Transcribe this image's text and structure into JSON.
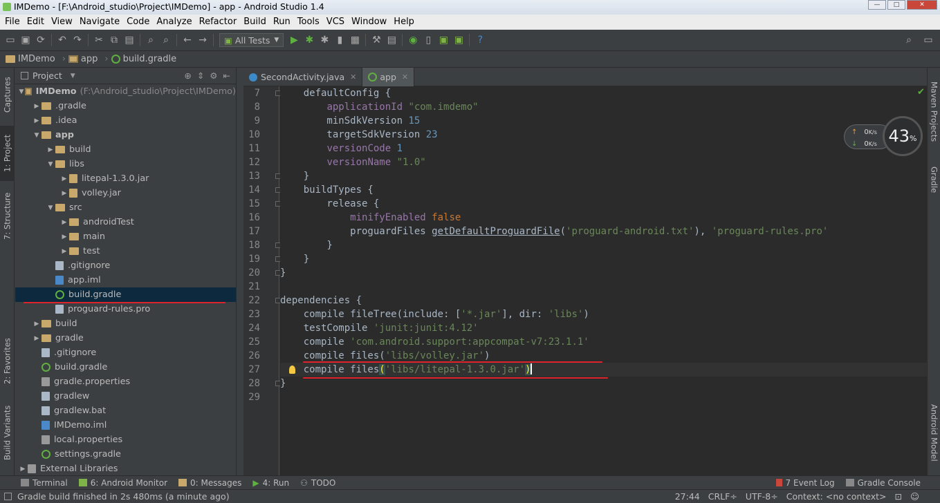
{
  "window": {
    "title": "IMDemo - [F:\\Android_studio\\Project\\IMDemo] - app - Android Studio 1.4"
  },
  "menu": [
    "File",
    "Edit",
    "View",
    "Navigate",
    "Code",
    "Analyze",
    "Refactor",
    "Build",
    "Run",
    "Tools",
    "VCS",
    "Window",
    "Help"
  ],
  "toolbar": {
    "run_config": "All Tests"
  },
  "breadcrumb": [
    "IMDemo",
    "app",
    "build.gradle"
  ],
  "left_tabs": [
    "1: Project",
    "7: Structure",
    "Captures",
    "2: Favorites",
    "Build Variants"
  ],
  "right_tabs": [
    "Maven Projects",
    "Gradle",
    "Android Model"
  ],
  "project_panel": {
    "title": "Project",
    "root_name": "IMDemo",
    "root_path": "(F:\\Android_studio\\Project\\IMDemo)",
    "tree": [
      {
        "label": ".gradle",
        "depth": 1,
        "toggle": "▶",
        "type": "folder"
      },
      {
        "label": ".idea",
        "depth": 1,
        "toggle": "▶",
        "type": "folder"
      },
      {
        "label": "app",
        "depth": 1,
        "toggle": "▼",
        "type": "folder"
      },
      {
        "label": "build",
        "depth": 2,
        "toggle": "▶",
        "type": "folder"
      },
      {
        "label": "libs",
        "depth": 2,
        "toggle": "▼",
        "type": "folder"
      },
      {
        "label": "litepal-1.3.0.jar",
        "depth": 3,
        "toggle": "▶",
        "type": "jar"
      },
      {
        "label": "volley.jar",
        "depth": 3,
        "toggle": "▶",
        "type": "jar"
      },
      {
        "label": "src",
        "depth": 2,
        "toggle": "▼",
        "type": "folder"
      },
      {
        "label": "androidTest",
        "depth": 3,
        "toggle": "▶",
        "type": "folder"
      },
      {
        "label": "main",
        "depth": 3,
        "toggle": "▶",
        "type": "folder"
      },
      {
        "label": "test",
        "depth": 3,
        "toggle": "▶",
        "type": "folder"
      },
      {
        "label": ".gitignore",
        "depth": 2,
        "toggle": "",
        "type": "file"
      },
      {
        "label": "app.iml",
        "depth": 2,
        "toggle": "",
        "type": "iml"
      },
      {
        "label": "build.gradle",
        "depth": 2,
        "toggle": "",
        "type": "gradle"
      },
      {
        "label": "proguard-rules.pro",
        "depth": 2,
        "toggle": "",
        "type": "file"
      },
      {
        "label": "build",
        "depth": 1,
        "toggle": "▶",
        "type": "folder"
      },
      {
        "label": "gradle",
        "depth": 1,
        "toggle": "▶",
        "type": "folder"
      },
      {
        "label": ".gitignore",
        "depth": 1,
        "toggle": "",
        "type": "file"
      },
      {
        "label": "build.gradle",
        "depth": 1,
        "toggle": "",
        "type": "gradle"
      },
      {
        "label": "gradle.properties",
        "depth": 1,
        "toggle": "",
        "type": "prop"
      },
      {
        "label": "gradlew",
        "depth": 1,
        "toggle": "",
        "type": "file"
      },
      {
        "label": "gradlew.bat",
        "depth": 1,
        "toggle": "",
        "type": "file"
      },
      {
        "label": "IMDemo.iml",
        "depth": 1,
        "toggle": "",
        "type": "iml"
      },
      {
        "label": "local.properties",
        "depth": 1,
        "toggle": "",
        "type": "prop"
      },
      {
        "label": "settings.gradle",
        "depth": 1,
        "toggle": "",
        "type": "gradle"
      },
      {
        "label": "External Libraries",
        "depth": 0,
        "toggle": "▶",
        "type": "lib"
      }
    ]
  },
  "editor": {
    "tabs": [
      {
        "label": "SecondActivity.java",
        "active": false
      },
      {
        "label": "app",
        "active": true
      }
    ],
    "line_numbers": [
      "7",
      "8",
      "9",
      "10",
      "11",
      "12",
      "13",
      "14",
      "15",
      "16",
      "17",
      "18",
      "19",
      "20",
      "21",
      "22",
      "23",
      "24",
      "25",
      "26",
      "27",
      "28",
      "29"
    ],
    "lines": [
      [
        {
          "t": "    defaultConfig {",
          "c": ""
        }
      ],
      [
        {
          "t": "        ",
          "c": ""
        },
        {
          "t": "applicationId",
          "c": "p"
        },
        {
          "t": " ",
          "c": ""
        },
        {
          "t": "\"com.imdemo\"",
          "c": "s"
        }
      ],
      [
        {
          "t": "        minSdkVersion ",
          "c": ""
        },
        {
          "t": "15",
          "c": "n"
        }
      ],
      [
        {
          "t": "        targetSdkVersion ",
          "c": ""
        },
        {
          "t": "23",
          "c": "n"
        }
      ],
      [
        {
          "t": "        ",
          "c": ""
        },
        {
          "t": "versionCode",
          "c": "p"
        },
        {
          "t": " ",
          "c": ""
        },
        {
          "t": "1",
          "c": "n"
        }
      ],
      [
        {
          "t": "        ",
          "c": ""
        },
        {
          "t": "versionName",
          "c": "p"
        },
        {
          "t": " ",
          "c": ""
        },
        {
          "t": "\"1.0\"",
          "c": "s"
        }
      ],
      [
        {
          "t": "    }",
          "c": ""
        }
      ],
      [
        {
          "t": "    buildTypes {",
          "c": ""
        }
      ],
      [
        {
          "t": "        release {",
          "c": ""
        }
      ],
      [
        {
          "t": "            ",
          "c": ""
        },
        {
          "t": "minifyEnabled",
          "c": "p"
        },
        {
          "t": " ",
          "c": ""
        },
        {
          "t": "false",
          "c": "k"
        }
      ],
      [
        {
          "t": "            proguardFiles ",
          "c": ""
        },
        {
          "t": "getDefaultProguardFile",
          "c": "u"
        },
        {
          "t": "(",
          "c": ""
        },
        {
          "t": "'proguard-android.txt'",
          "c": "s"
        },
        {
          "t": "), ",
          "c": ""
        },
        {
          "t": "'proguard-rules.pro'",
          "c": "s"
        }
      ],
      [
        {
          "t": "        }",
          "c": ""
        }
      ],
      [
        {
          "t": "    }",
          "c": ""
        }
      ],
      [
        {
          "t": "}",
          "c": ""
        }
      ],
      [
        {
          "t": "",
          "c": ""
        }
      ],
      [
        {
          "t": "dependencies {",
          "c": ""
        }
      ],
      [
        {
          "t": "    compile fileTree(include: [",
          "c": ""
        },
        {
          "t": "'*.jar'",
          "c": "s"
        },
        {
          "t": "], dir: ",
          "c": ""
        },
        {
          "t": "'libs'",
          "c": "s"
        },
        {
          "t": ")",
          "c": ""
        }
      ],
      [
        {
          "t": "    testCompile ",
          "c": ""
        },
        {
          "t": "'junit:junit:4.12'",
          "c": "s"
        }
      ],
      [
        {
          "t": "    compile ",
          "c": ""
        },
        {
          "t": "'com.android.support:appcompat-v7:23.1.1'",
          "c": "s"
        }
      ],
      [
        {
          "t": "    compile files(",
          "c": ""
        },
        {
          "t": "'libs/volley.jar'",
          "c": "s"
        },
        {
          "t": ")",
          "c": ""
        }
      ],
      [
        {
          "t": "    compile files",
          "c": ""
        },
        {
          "t": "(",
          "c": "hl"
        },
        {
          "t": "'libs/litepal-1.3.0.jar'",
          "c": "s"
        },
        {
          "t": ")",
          "c": "hl"
        }
      ],
      [
        {
          "t": "}",
          "c": ""
        }
      ],
      [
        {
          "t": "",
          "c": ""
        }
      ]
    ]
  },
  "net_widget": {
    "up": "0",
    "down": "0",
    "unit": "K/s",
    "percent": "43",
    "percent_sign": "%"
  },
  "bottom_tools": [
    "Terminal",
    "6: Android Monitor",
    "0: Messages",
    "4: Run",
    "TODO",
    "7 Event Log",
    "Gradle Console"
  ],
  "status": {
    "message": "Gradle build finished in 2s 480ms (a minute ago)",
    "position": "27:44",
    "line_sep": "CRLF÷",
    "encoding": "UTF-8÷",
    "context": "Context: <no context>"
  },
  "colors": {
    "accent_green": "#5fb041",
    "selection": "#0d293e",
    "annotation_red": "#e0232b",
    "editor_bg": "#2b2b2b"
  }
}
